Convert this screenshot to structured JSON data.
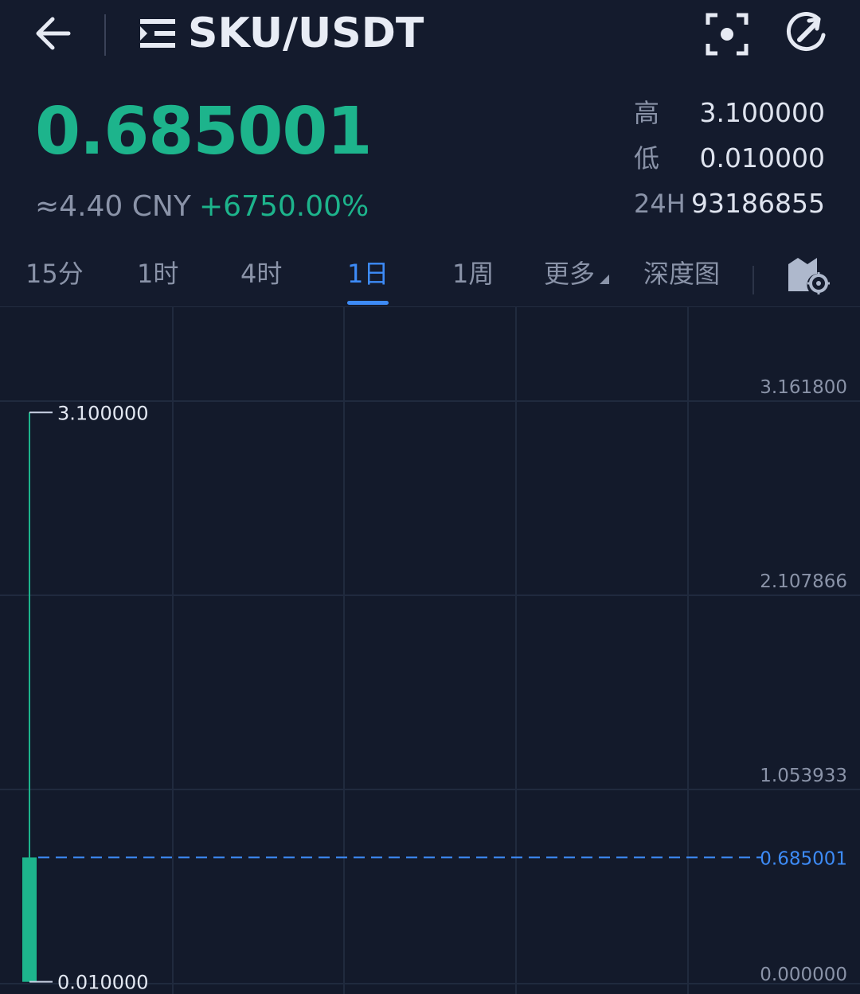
{
  "header": {
    "pair": "SKU/USDT",
    "icons": {
      "back": "back-arrow-icon",
      "menu": "menu-icon",
      "scan": "scan-icon",
      "refresh": "refresh-icon"
    }
  },
  "price": {
    "last": "0.685001",
    "cny": "≈4.40 CNY",
    "change": "+6750.00%"
  },
  "stats": [
    {
      "label": "高",
      "value": "3.100000"
    },
    {
      "label": "低",
      "value": "0.010000"
    },
    {
      "label": "24H",
      "value": "93186855"
    }
  ],
  "tabs": [
    {
      "label": "15分",
      "active": false
    },
    {
      "label": "1时",
      "active": false
    },
    {
      "label": "4时",
      "active": false
    },
    {
      "label": "1日",
      "active": true
    },
    {
      "label": "1周",
      "active": false
    },
    {
      "label": "更多",
      "active": false
    },
    {
      "label": "深度图",
      "active": false
    }
  ],
  "colors": {
    "up": "#1db48c",
    "accent": "#3d8bf7",
    "background": "#141b2d",
    "muted": "#8a93a8"
  },
  "chart_data": {
    "type": "candlestick",
    "y_ticks": [
      "3.161800",
      "2.107866",
      "1.053933",
      "0.000000"
    ],
    "y_tick_values": [
      3.1618,
      2.107866,
      1.053933,
      0.0
    ],
    "current_price_label": "0.685001",
    "current_price": 0.685001,
    "candles": [
      {
        "open": 0.01,
        "close": 0.685001,
        "high": 3.1,
        "low": 0.01
      }
    ],
    "high_marker": "3.100000",
    "low_marker": "0.010000",
    "grid": true
  }
}
